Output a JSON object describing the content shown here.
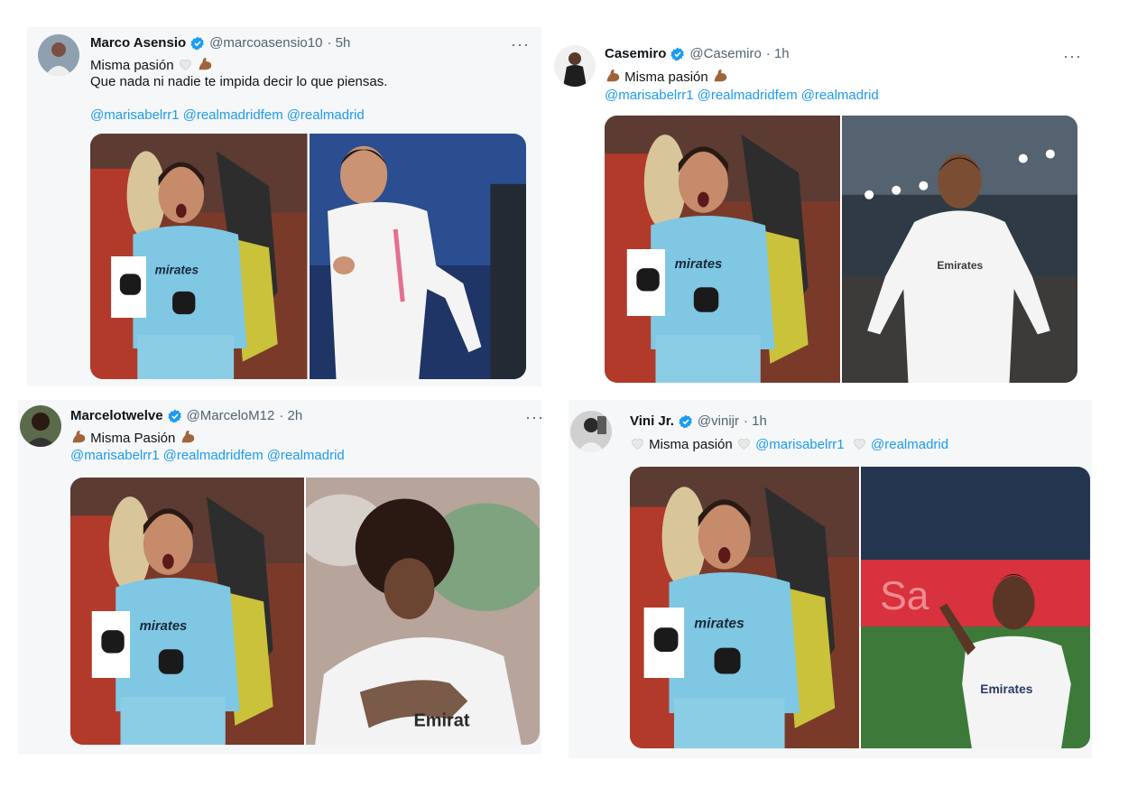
{
  "tweets": [
    {
      "name": "Marco Asensio",
      "handle": "@marcoasensio10",
      "time": "· 5h",
      "text1": "Misma pasión",
      "text2": "Que nada ni nadie te impida decir lo que piensas.",
      "mentions": [
        "@marisabelrr1",
        "@realmadridfem",
        "@realmadrid"
      ]
    },
    {
      "name": "Casemiro",
      "handle": "@Casemiro",
      "time": "· 1h",
      "text1": "Misma pasión",
      "mentions": [
        "@marisabelrr1",
        "@realmadridfem",
        "@realmadrid"
      ]
    },
    {
      "name": "Marcelotwelve",
      "handle": "@MarceloM12",
      "time": "· 2h",
      "text1": "Misma Pasión",
      "mentions": [
        "@marisabelrr1",
        "@realmadridfem",
        "@realmadrid"
      ]
    },
    {
      "name": "Vini Jr.",
      "handle": "@vinijr",
      "time": "· 1h",
      "text1": "Misma pasión",
      "mentions": [
        "@marisabelrr1",
        "@realmadrid"
      ]
    }
  ],
  "more_label": "···",
  "colors": {
    "mention": "#1d9bf0",
    "verified": "#1d9bf0",
    "card": "#f5f7f8"
  }
}
